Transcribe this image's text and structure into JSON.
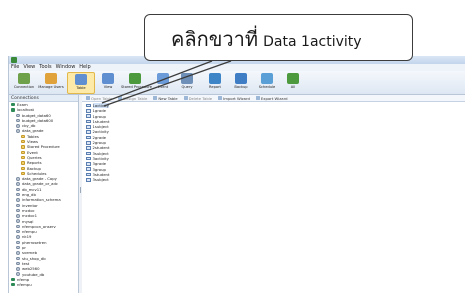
{
  "callout": {
    "text_thai": "คลิกขวาที่",
    "text_target": "Data  1activity"
  },
  "menu": [
    "File",
    "View",
    "Tools",
    "Window",
    "Help"
  ],
  "toolbar": [
    {
      "label": "Connection",
      "icon": "connection-icon",
      "color": "#6fa04a"
    },
    {
      "label": "Manage Users",
      "icon": "users-icon",
      "color": "#e0a23a"
    },
    {
      "label": "Table",
      "icon": "table-icon",
      "color": "#5f8fd0"
    },
    {
      "label": "View",
      "icon": "view-icon",
      "color": "#5f8fd0"
    },
    {
      "label": "Stored Procedure",
      "icon": "procedure-icon",
      "color": "#4d9a3e"
    },
    {
      "label": "Event",
      "icon": "event-icon",
      "color": "#6b9bd8"
    },
    {
      "label": "Query",
      "icon": "query-icon",
      "color": "#6e8fb8"
    },
    {
      "label": "Report",
      "icon": "report-icon",
      "color": "#3d85c6"
    },
    {
      "label": "Backup",
      "icon": "backup-icon",
      "color": "#3f7ec4"
    },
    {
      "label": "Schedule",
      "icon": "schedule-icon",
      "color": "#5aa0d6"
    },
    {
      "label": "All",
      "icon": "all-icon",
      "color": "#4d9a3e"
    }
  ],
  "left_pane": {
    "header": "Connections",
    "tree": [
      {
        "label": "Exam",
        "icon": "server",
        "indent": 0
      },
      {
        "label": "localhost",
        "icon": "server",
        "indent": 0
      },
      {
        "label": "budget_data60",
        "icon": "db",
        "indent": 1
      },
      {
        "label": "budget_data600",
        "icon": "db",
        "indent": 1
      },
      {
        "label": "cby_db",
        "icon": "db",
        "indent": 1
      },
      {
        "label": "data_grade",
        "icon": "db",
        "indent": 1
      },
      {
        "label": "Tables",
        "icon": "fold",
        "indent": 2
      },
      {
        "label": "Views",
        "icon": "fold",
        "indent": 2
      },
      {
        "label": "Stored Procedure",
        "icon": "fold",
        "indent": 2
      },
      {
        "label": "Event",
        "icon": "fold",
        "indent": 2
      },
      {
        "label": "Queries",
        "icon": "fold",
        "indent": 2
      },
      {
        "label": "Reports",
        "icon": "fold",
        "indent": 2
      },
      {
        "label": "Backup",
        "icon": "fold",
        "indent": 2
      },
      {
        "label": "Schedules",
        "icon": "fold",
        "indent": 2
      },
      {
        "label": "data_grade - Copy",
        "icon": "db",
        "indent": 1
      },
      {
        "label": "data_grade_or_adc",
        "icon": "db",
        "indent": 1
      },
      {
        "label": "db_mcv11",
        "icon": "db",
        "indent": 1
      },
      {
        "label": "eng_db",
        "icon": "db",
        "indent": 1
      },
      {
        "label": "information_schema",
        "icon": "db",
        "indent": 1
      },
      {
        "label": "inventor",
        "icon": "db",
        "indent": 1
      },
      {
        "label": "mcdoc",
        "icon": "db",
        "indent": 1
      },
      {
        "label": "mcdoc1",
        "icon": "db",
        "indent": 1
      },
      {
        "label": "mysql",
        "icon": "db",
        "indent": 1
      },
      {
        "label": "nfempcon_onserv",
        "icon": "db",
        "indent": 1
      },
      {
        "label": "nfempu",
        "icon": "db",
        "indent": 1
      },
      {
        "label": "nk19",
        "icon": "db",
        "indent": 1
      },
      {
        "label": "pherrosetren",
        "icon": "db",
        "indent": 1
      },
      {
        "label": "pr",
        "icon": "db",
        "indent": 1
      },
      {
        "label": "svemeb",
        "icon": "db",
        "indent": 1
      },
      {
        "label": "stu_shop_db",
        "icon": "db",
        "indent": 1
      },
      {
        "label": "test",
        "icon": "db",
        "indent": 1
      },
      {
        "label": "web2560",
        "icon": "db",
        "indent": 1
      },
      {
        "label": "youtube_db",
        "icon": "db",
        "indent": 1
      },
      {
        "label": "nfemp",
        "icon": "server",
        "indent": 0
      },
      {
        "label": "nfempu",
        "icon": "server",
        "indent": 0
      }
    ]
  },
  "content": {
    "subtoolbar": [
      {
        "label": "Open Table",
        "enabled": false
      },
      {
        "label": "Design Table",
        "enabled": false
      },
      {
        "label": "New Table",
        "enabled": true
      },
      {
        "label": "Delete Table",
        "enabled": false
      },
      {
        "label": "Import Wizard",
        "enabled": true
      },
      {
        "label": "Export Wizard",
        "enabled": true
      }
    ],
    "tables": [
      "1activity",
      "1grade",
      "1group",
      "1student",
      "1subject",
      "2activity",
      "2grade",
      "2group",
      "2student",
      "3subject",
      "3activity",
      "3grade",
      "3group",
      "3student",
      "3subject"
    ],
    "selected_index": 0
  }
}
